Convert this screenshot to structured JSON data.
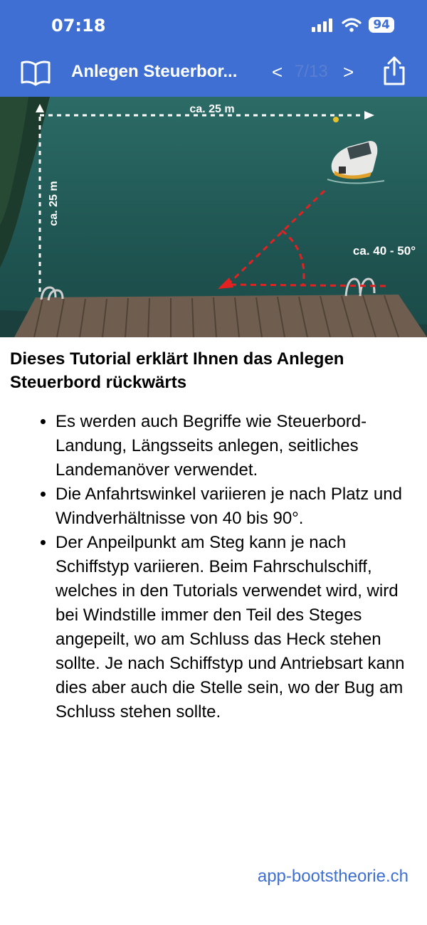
{
  "status_bar": {
    "time": "07:18",
    "battery": "94"
  },
  "nav": {
    "title": "Anlegen Steuerbor...",
    "prev": "<",
    "page": "7/13",
    "next": ">"
  },
  "hero": {
    "label_width": "ca. 25 m",
    "label_height": "ca. 25 m",
    "label_angle": "ca. 40 - 50°"
  },
  "content": {
    "heading": "Dieses Tutorial erklärt Ihnen das Anlegen Steuerbord rückwärts",
    "bullets": [
      "Es werden auch Begriffe wie Steuerbord-Landung, Längsseits anlegen, seitliches Landemanöver verwendet.",
      "Die Anfahrtswinkel variieren je nach Platz und Windverhältnisse von 40 bis 90°.",
      "Der Anpeilpunkt am Steg kann je nach Schiffstyp variieren. Beim Fahrschulschiff, welches in den Tutorials verwendet wird, wird bei Windstille immer den Teil des Steges angepeilt, wo am Schluss das Heck stehen sollte. Je nach Schiffstyp und Antriebsart kann dies aber auch die Stelle sein, wo der Bug am Schluss stehen sollte."
    ]
  },
  "footer": {
    "link": "app-bootstheorie.ch"
  },
  "colors": {
    "accent": "#3f6fd3",
    "water": "#1f5552",
    "dock": "#6f5e4f",
    "arrow": "#e32121"
  }
}
